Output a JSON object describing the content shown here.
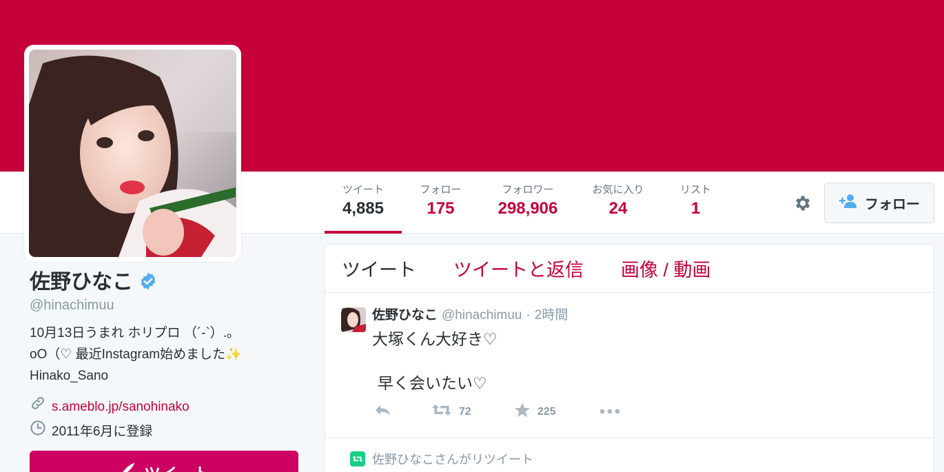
{
  "theme": {
    "accent": "#c5003a",
    "tweet_button_color": "#cc0060",
    "verified_color": "#55acee"
  },
  "profile": {
    "name": "佐野ひなこ",
    "verified": true,
    "screen_name": "@hinachimuu",
    "bio_lines": [
      "10月13日うまれ ホリプロ （´-`）.｡",
      "oO（♡ 最近Instagram始めました✨",
      "Hinako_Sano"
    ],
    "link": "s.ameblo.jp/sanohinako",
    "joined": "2011年6月に登録",
    "tweet_button": "ツイート"
  },
  "stats": [
    {
      "label": "ツイート",
      "value": "4,885",
      "active": true
    },
    {
      "label": "フォロー",
      "value": "175"
    },
    {
      "label": "フォロワー",
      "value": "298,906"
    },
    {
      "label": "お気に入り",
      "value": "24"
    },
    {
      "label": "リスト",
      "value": "1"
    }
  ],
  "follow_button": "フォロー",
  "timeline": {
    "tabs": [
      "ツイート",
      "ツイートと返信",
      "画像 / 動画"
    ],
    "active_tab": 0,
    "tweet": {
      "author": "佐野ひなこ",
      "handle": "@hinachimuu",
      "separator": "·",
      "time": "2時間",
      "lines": [
        "大塚くん大好き♡",
        "早く会いたい♡"
      ],
      "retweets": "72",
      "favorites": "225"
    },
    "retweet_note": "佐野ひなこさんがリツイート"
  },
  "icons": [
    "gear-icon",
    "add-user-icon",
    "verified-icon",
    "link-icon",
    "clock-icon",
    "reply-icon",
    "retweet-icon",
    "star-icon",
    "more-icon"
  ]
}
